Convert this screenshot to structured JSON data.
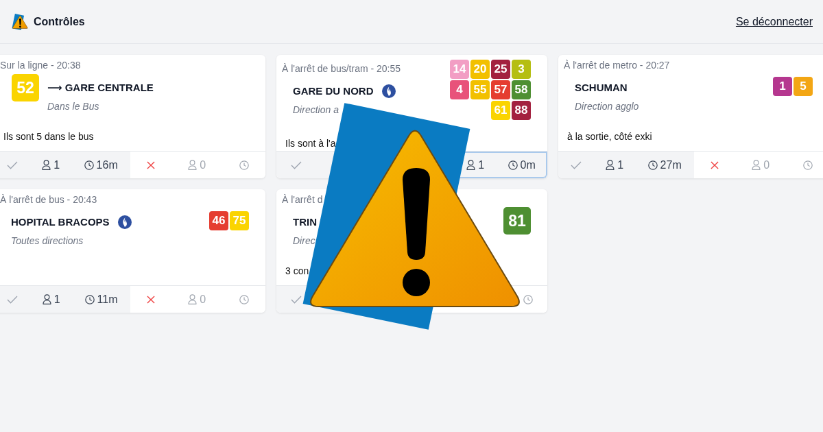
{
  "header": {
    "title": "Contrôles",
    "logout": "Se déconnecter"
  },
  "reports": [
    {
      "kind": "on_line",
      "context": "Sur la ligne - 20:38",
      "title": "⟶ GARE CENTRALE",
      "police": false,
      "subtitle": "Dans le Bus",
      "lines": [
        {
          "number": "52",
          "color": "#fad400"
        }
      ],
      "comment": "Ils sont 5 dans le bus",
      "votes": [
        {
          "highlighted": true,
          "focused": false,
          "cells": [
            {
              "kind": "check"
            },
            {
              "kind": "people",
              "count": "1"
            },
            {
              "kind": "time",
              "text": "16m"
            }
          ]
        },
        {
          "highlighted": false,
          "focused": false,
          "cells": [
            {
              "kind": "cross"
            },
            {
              "kind": "people",
              "count": "0"
            },
            {
              "kind": "time"
            }
          ]
        }
      ]
    },
    {
      "kind": "at_stop",
      "context": "À l'arrêt de bus/tram - 20:55",
      "title": "GARE DU NORD",
      "police": true,
      "subtitle": "Direction a",
      "lines": [
        {
          "number": "14",
          "color": "#f29ec4"
        },
        {
          "number": "20",
          "color": "#f2c000"
        },
        {
          "number": "25",
          "color": "#a3213f"
        },
        {
          "number": "3",
          "color": "#b5be12"
        },
        {
          "number": "4",
          "color": "#e8527a"
        },
        {
          "number": "55",
          "color": "#f2c000"
        },
        {
          "number": "57",
          "color": "#e53d30"
        },
        {
          "number": "58",
          "color": "#4e8f32"
        },
        {
          "number": "61",
          "color": "#fad400"
        },
        {
          "number": "88",
          "color": "#a3213f"
        }
      ],
      "comment": "Ils sont à l'a",
      "votes": [
        {
          "highlighted": true,
          "focused": false,
          "cells": [
            {
              "kind": "check"
            },
            {
              "kind": "covered"
            },
            {
              "kind": "covered"
            }
          ]
        },
        {
          "highlighted": true,
          "focused": true,
          "cells": [
            {
              "kind": "covered"
            },
            {
              "kind": "people",
              "count": "1"
            },
            {
              "kind": "time",
              "text": "0m"
            }
          ]
        }
      ]
    },
    {
      "kind": "at_stop",
      "context": "À l'arrêt de metro - 20:27",
      "title": "SCHUMAN",
      "police": false,
      "subtitle": "Direction agglo",
      "lines": [
        {
          "number": "1",
          "color": "#b5378f"
        },
        {
          "number": "5",
          "color": "#f3a614"
        }
      ],
      "comment": "à la sortie, côté exki",
      "votes": [
        {
          "highlighted": true,
          "focused": false,
          "cells": [
            {
              "kind": "check"
            },
            {
              "kind": "people",
              "count": "1"
            },
            {
              "kind": "time",
              "text": "27m"
            }
          ]
        },
        {
          "highlighted": false,
          "focused": false,
          "cells": [
            {
              "kind": "cross"
            },
            {
              "kind": "people",
              "count": "0"
            },
            {
              "kind": "time"
            }
          ]
        }
      ]
    },
    {
      "kind": "at_stop",
      "context": "À l'arrêt de bus - 20:43",
      "title": "HOPITAL BRACOPS",
      "police": true,
      "subtitle": "Toutes directions",
      "lines": [
        {
          "number": "46",
          "color": "#e53d30"
        },
        {
          "number": "75",
          "color": "#fad400"
        }
      ],
      "votes": [
        {
          "highlighted": true,
          "focused": false,
          "cells": [
            {
              "kind": "check"
            },
            {
              "kind": "people",
              "count": "1"
            },
            {
              "kind": "time",
              "text": "11m"
            }
          ]
        },
        {
          "highlighted": false,
          "focused": false,
          "cells": [
            {
              "kind": "cross"
            },
            {
              "kind": "people",
              "count": "0"
            },
            {
              "kind": "time"
            }
          ]
        }
      ]
    },
    {
      "kind": "at_stop",
      "context": "À l'arrêt d",
      "title": "TRIN",
      "subtitle": "Direc",
      "lines": [
        {
          "number": "81",
          "color": "#4e8f32"
        }
      ],
      "comment": "3 con",
      "votes": [
        {
          "highlighted": true,
          "cells": [
            {
              "kind": "check"
            },
            {
              "kind": "covered"
            },
            {
              "kind": "covered"
            }
          ]
        },
        {
          "highlighted": false,
          "cells": [
            {
              "kind": "covered"
            },
            {
              "kind": "covered"
            },
            {
              "kind": "time"
            }
          ]
        }
      ]
    }
  ]
}
